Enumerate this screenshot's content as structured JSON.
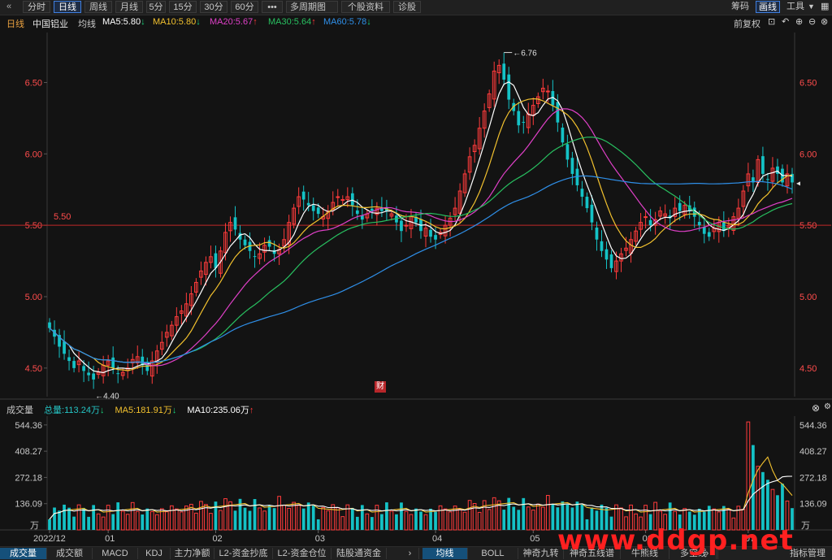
{
  "toolbar": {
    "collapse_icon": "«",
    "periods": [
      "分时",
      "日线",
      "周线",
      "月线",
      "5分",
      "15分",
      "30分",
      "60分",
      "•••",
      "多周期图",
      "个股资料",
      "诊股"
    ],
    "active_period": "日线",
    "right_items": [
      "筹码",
      "画线",
      "工具"
    ]
  },
  "info": {
    "period": "日线",
    "stock_name": "中国铝业",
    "avg_label": "均线",
    "ma": [
      {
        "label": "MA5:5.80",
        "dir": "down",
        "color": "#ffffff"
      },
      {
        "label": "MA10:5.80",
        "dir": "down",
        "color": "#f2c12e"
      },
      {
        "label": "MA20:5.67",
        "dir": "up",
        "color": "#e040c8"
      },
      {
        "label": "MA30:5.64",
        "dir": "up",
        "color": "#28c060"
      },
      {
        "label": "MA60:5.78",
        "dir": "down",
        "color": "#2f8fe8"
      }
    ],
    "adjust_label": "前复权",
    "arrow_up": "↑",
    "arrow_down": "↓"
  },
  "chart_data": [
    {
      "type": "candlestick",
      "title": "中国铝业 日线",
      "ylim": [
        4.3,
        6.85
      ],
      "yticks": [
        4.5,
        5.0,
        5.5,
        6.0,
        6.5
      ],
      "ytick_labels": [
        "4.50",
        "5.00",
        "5.50",
        "6.00",
        "6.50"
      ],
      "reference_line": {
        "value": 5.5,
        "label": "5.50"
      },
      "annotations": [
        {
          "label": "6.76",
          "kind": "high"
        },
        {
          "label": "4.40",
          "kind": "low"
        }
      ],
      "x_ticks": [
        "2022/12",
        "01",
        "02",
        "03",
        "04",
        "05",
        "06",
        "07"
      ],
      "close": [
        4.78,
        4.72,
        4.65,
        4.6,
        4.55,
        4.5,
        4.55,
        4.48,
        4.45,
        4.42,
        4.47,
        4.52,
        4.55,
        4.5,
        4.46,
        4.47,
        4.5,
        4.56,
        4.58,
        4.52,
        4.48,
        4.55,
        4.62,
        4.68,
        4.75,
        4.8,
        4.86,
        4.9,
        4.95,
        5.02,
        5.1,
        5.18,
        5.24,
        5.28,
        5.2,
        5.32,
        5.45,
        5.52,
        5.47,
        5.4,
        5.36,
        5.32,
        5.28,
        5.3,
        5.36,
        5.35,
        5.3,
        5.33,
        5.4,
        5.52,
        5.62,
        5.7,
        5.68,
        5.64,
        5.6,
        5.58,
        5.56,
        5.6,
        5.66,
        5.7,
        5.68,
        5.7,
        5.64,
        5.58,
        5.54,
        5.58,
        5.6,
        5.62,
        5.6,
        5.6,
        5.58,
        5.52,
        5.46,
        5.5,
        5.56,
        5.52,
        5.46,
        5.48,
        5.42,
        5.4,
        5.45,
        5.5,
        5.55,
        5.62,
        5.74,
        5.86,
        5.98,
        6.06,
        6.18,
        6.3,
        6.42,
        6.58,
        6.62,
        6.52,
        6.38,
        6.3,
        6.2,
        6.22,
        6.28,
        6.34,
        6.4,
        6.46,
        6.44,
        6.34,
        6.22,
        6.08,
        5.96,
        5.86,
        5.78,
        5.7,
        5.62,
        5.52,
        5.4,
        5.32,
        5.26,
        5.2,
        5.25,
        5.3,
        5.34,
        5.4,
        5.46,
        5.52,
        5.56,
        5.5,
        5.54,
        5.6,
        5.58,
        5.55,
        5.62,
        5.6,
        5.64,
        5.6,
        5.56,
        5.5,
        5.44,
        5.42,
        5.48,
        5.52,
        5.46,
        5.5,
        5.56,
        5.62,
        5.74,
        5.86,
        5.8,
        5.96,
        5.86,
        5.82,
        5.9,
        5.86,
        5.8,
        5.86,
        5.8
      ],
      "volume": {
        "yticks": [
          136.09,
          272.18,
          408.27,
          544.36
        ],
        "ytick_labels": [
          "136.09",
          "272.18",
          "408.27",
          "544.36"
        ],
        "unit": "万",
        "total_label": "总量:113.24万",
        "total_dir": "down",
        "ma5_label": "MA5:181.91万",
        "ma5_dir": "down",
        "ma10_label": "MA10:235.06万",
        "ma10_dir": "up",
        "panel_title": "成交量"
      }
    }
  ],
  "bottom_tabs_left": [
    "成交量",
    "成交额",
    "MACD",
    "KDJ",
    "主力净额",
    "L2-资金抄底",
    "L2-资金仓位",
    "陆股通资金"
  ],
  "active_left_tab": "成交量",
  "bottom_tabs_right": [
    "均线",
    "BOLL",
    "神奇九转",
    "神奇五线谱",
    "牛熊线",
    "多空线"
  ],
  "active_right_tab": "均线",
  "indicator_manage": "指标管理",
  "fin_badge": "财",
  "watermark": "www.ddgp.net",
  "colors": {
    "up": "#ff3b3b",
    "down": "#14c2c6",
    "ref_line": "#c02828",
    "axis_text": "#ff4c4c",
    "background": "#131313"
  }
}
